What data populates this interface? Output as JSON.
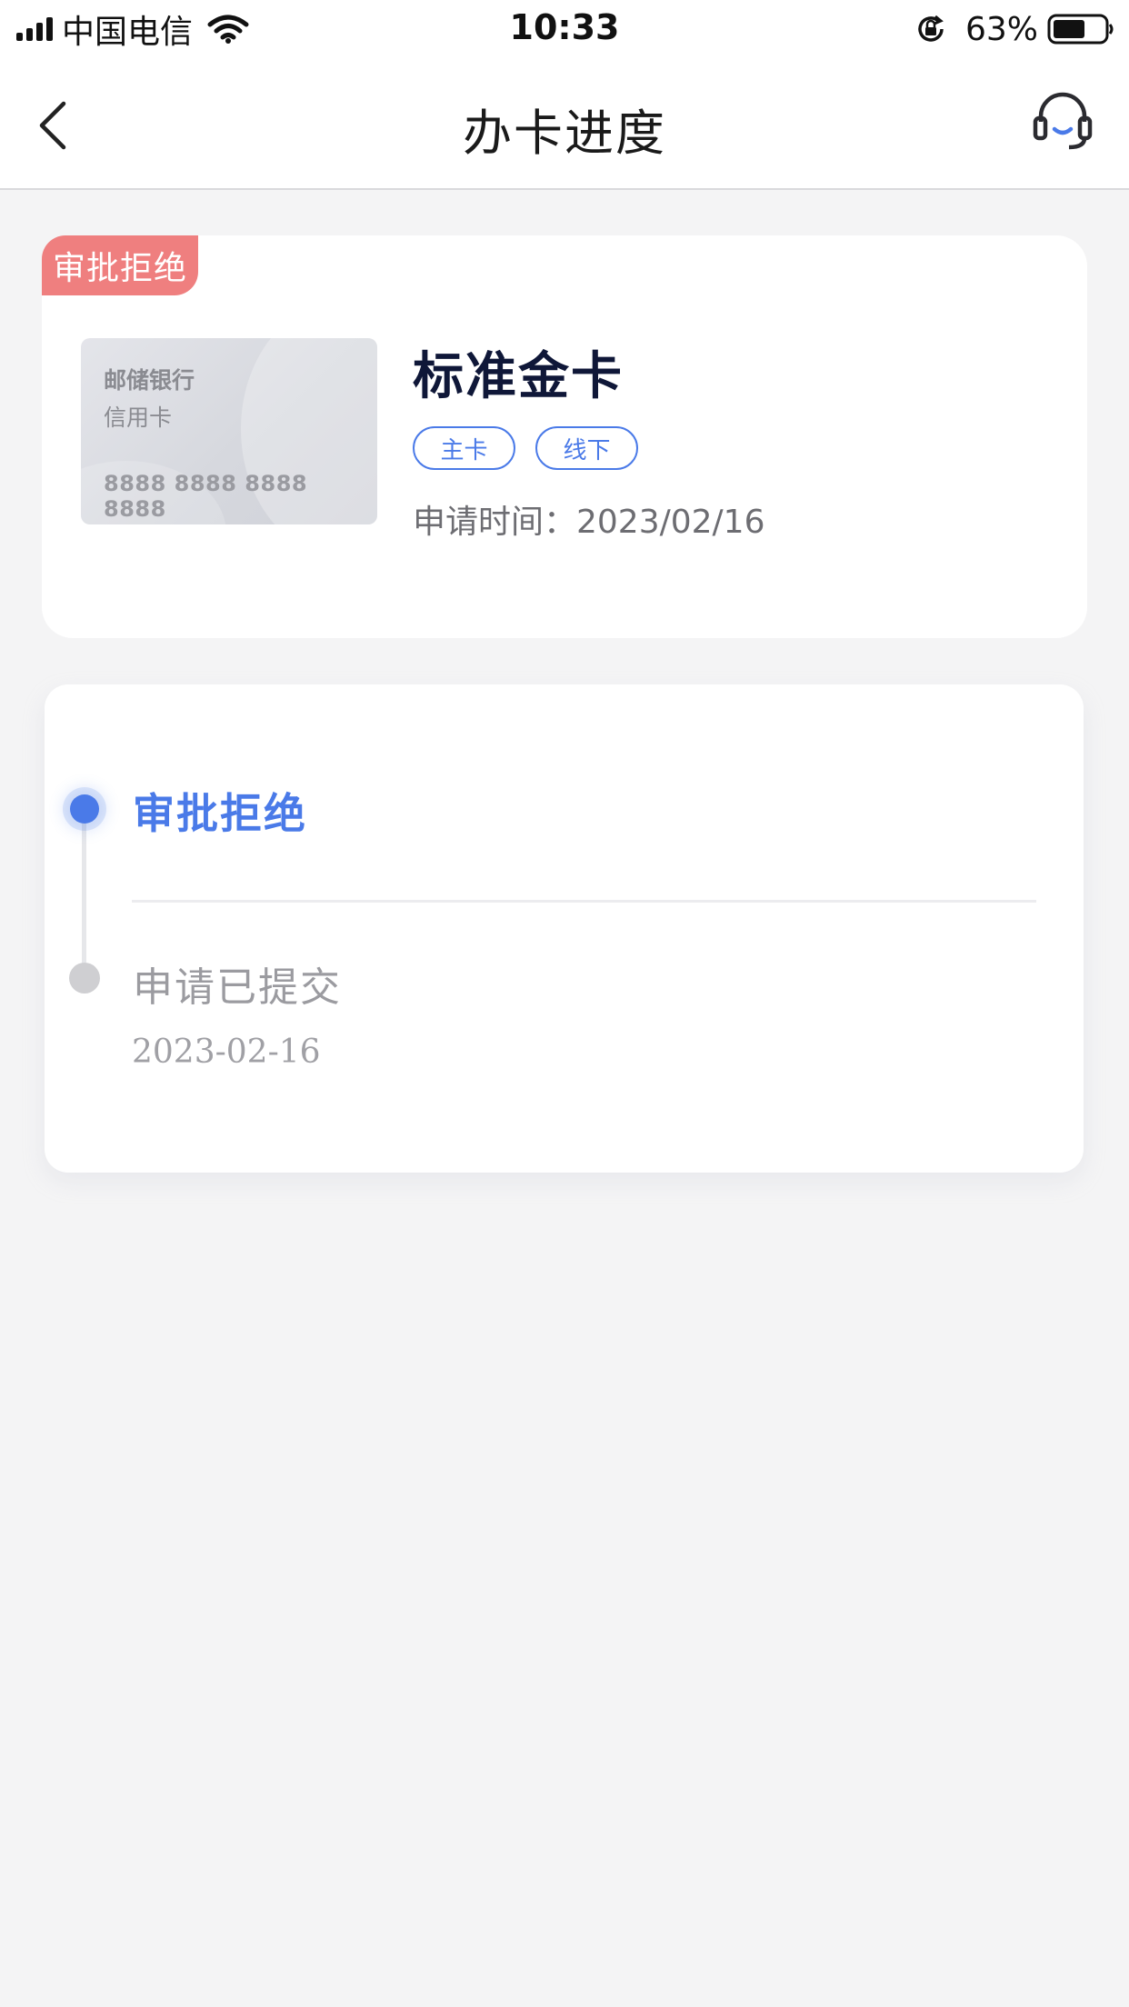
{
  "status_bar": {
    "carrier": "中国电信",
    "time": "10:33",
    "battery_percent": "63%",
    "battery_level": 0.63,
    "icons": [
      "signal-icon",
      "wifi-icon",
      "rotation-lock-icon",
      "battery-icon"
    ]
  },
  "nav": {
    "title": "办卡进度",
    "back_icon": "chevron-left-icon",
    "service_icon": "customer-service-headset-icon"
  },
  "card": {
    "status_tag": "审批拒绝",
    "image": {
      "bank": "邮储银行",
      "type": "信用卡",
      "number": "8888 8888 8888 8888"
    },
    "name": "标准金卡",
    "tags": [
      "主卡",
      "线下"
    ],
    "apply_time": "申请时间：2023/02/16"
  },
  "progress": {
    "steps": [
      {
        "label": "审批拒绝",
        "state": "current"
      },
      {
        "label": "申请已提交",
        "date": "2023-02-16",
        "state": "done"
      }
    ]
  },
  "colors": {
    "accent": "#4a7ae8",
    "reject_tag": "#ef7f7f",
    "background": "#f4f4f5",
    "title_text": "#0f1738"
  }
}
